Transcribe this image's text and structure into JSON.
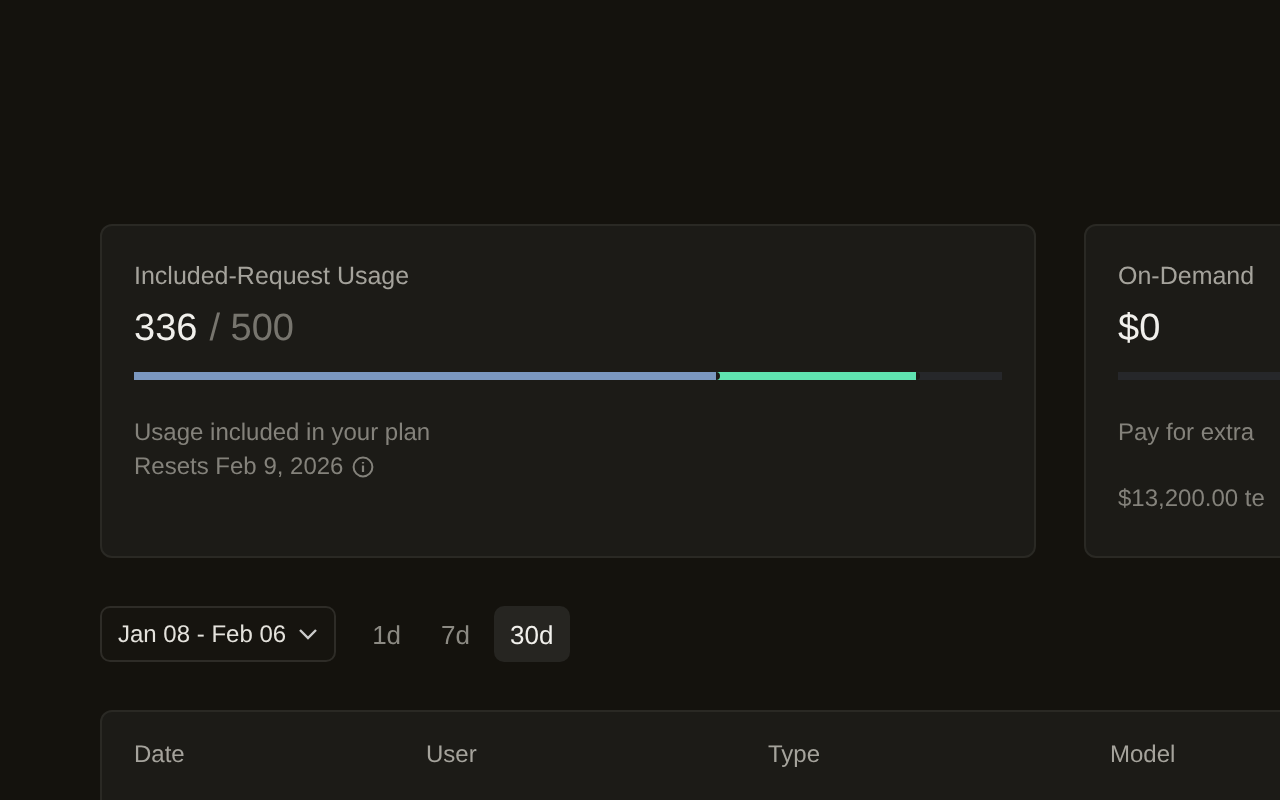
{
  "cards": [
    {
      "title": "Included-Request Usage",
      "value": "336",
      "total": "/ 500",
      "segments": [
        {
          "level": 0.9,
          "color": "#5fe3b0"
        },
        {
          "level": 0.67,
          "color": "#7b98c0"
        }
      ],
      "lines": [
        "Usage included in your plan",
        "Resets Feb 9, 2026"
      ],
      "info": true
    },
    {
      "title": "On-Demand",
      "value": "$0",
      "lines": [
        "Pay for extra",
        "$13,200.00 te"
      ],
      "info": false
    }
  ],
  "date_range": "Jan 08 - Feb 06",
  "ranges": [
    {
      "label": "1d",
      "selected": false
    },
    {
      "label": "7d",
      "selected": false
    },
    {
      "label": "30d",
      "selected": true
    }
  ],
  "table": {
    "columns": [
      "Date",
      "User",
      "Type",
      "Model"
    ]
  }
}
